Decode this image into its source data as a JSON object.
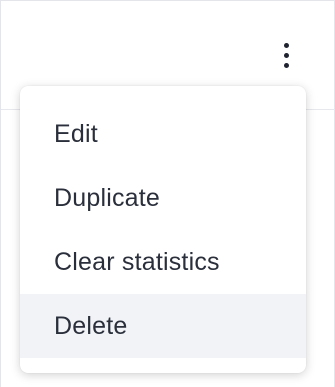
{
  "toolbar": {
    "more_icon": "kebab-vertical-icon"
  },
  "menu": {
    "items": [
      {
        "label": "Edit"
      },
      {
        "label": "Duplicate"
      },
      {
        "label": "Clear statistics"
      },
      {
        "label": "Delete"
      }
    ],
    "highlighted_item": "Delete"
  },
  "colors": {
    "text": "#2a2f3b",
    "icon": "#1f2330",
    "highlight_background": "#f2f3f7",
    "border": "#e3e5ea"
  }
}
